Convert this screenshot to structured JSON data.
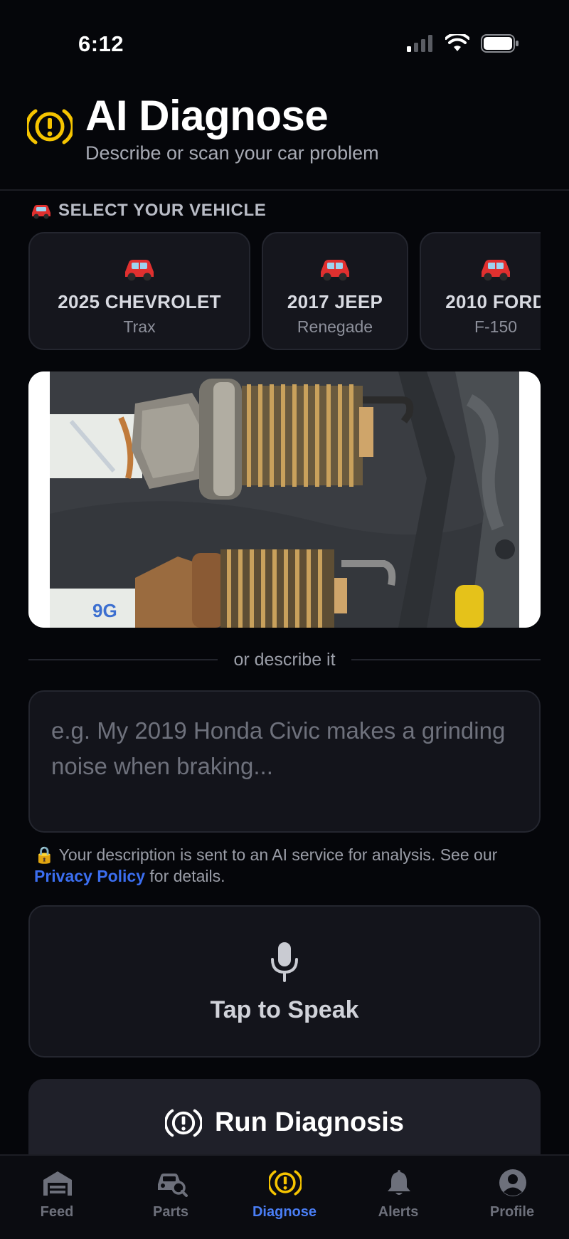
{
  "status_bar": {
    "time": "6:12"
  },
  "header": {
    "title": "AI Diagnose",
    "subtitle": "Describe or scan your car problem",
    "icon": "check-engine-warning-icon",
    "accent_color": "#f5c400"
  },
  "vehicle_section": {
    "label": "SELECT YOUR VEHICLE",
    "vehicles": [
      {
        "make": "2025 CHEVROLET",
        "model": "Trax"
      },
      {
        "make": "2017 JEEP",
        "model": "Renegade"
      },
      {
        "make": "2010 FORD",
        "model": "F-150"
      }
    ]
  },
  "photo": {
    "description_icon": "spark-plugs-photo"
  },
  "divider": {
    "text": "or describe it"
  },
  "description": {
    "placeholder": "e.g. My 2019 Honda Civic makes a grinding noise when braking...",
    "value": ""
  },
  "privacy": {
    "lock_icon": "🔒",
    "text_before": "Your description is sent to an AI service for analysis. See our",
    "link": "Privacy Policy",
    "text_after": "for details."
  },
  "speak": {
    "label": "Tap to Speak",
    "icon": "microphone-icon"
  },
  "run": {
    "label": "Run Diagnosis",
    "icon": "check-engine-warning-icon"
  },
  "tabs": [
    {
      "label": "Feed",
      "icon": "garage-icon",
      "active": false
    },
    {
      "label": "Parts",
      "icon": "car-search-icon",
      "active": false
    },
    {
      "label": "Diagnose",
      "icon": "check-engine-warning-icon",
      "active": true
    },
    {
      "label": "Alerts",
      "icon": "bell-icon",
      "active": false
    },
    {
      "label": "Profile",
      "icon": "profile-icon",
      "active": false
    }
  ],
  "colors": {
    "background": "#05060a",
    "card": "#15161d",
    "link": "#3b6ef0",
    "active_tab": "#4a7ef5"
  }
}
